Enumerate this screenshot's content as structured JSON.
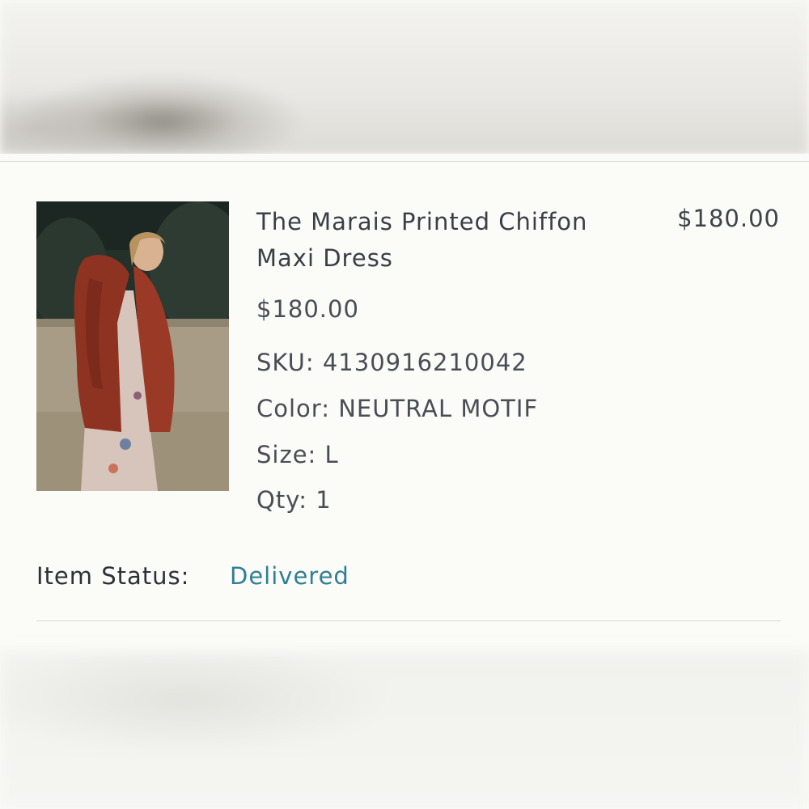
{
  "order_item": {
    "title": "The Marais Printed Chiffon Maxi Dress",
    "line_total": "$180.00",
    "unit_price": "$180.00",
    "sku": "SKU: 4130916210042",
    "color": "Color: NEUTRAL MOTIF",
    "size": "Size: L",
    "qty": "Qty: 1",
    "image_alt": "product-photo"
  },
  "status": {
    "label": "Item Status:",
    "value": "Delivered",
    "value_color": "#2f7f95"
  }
}
